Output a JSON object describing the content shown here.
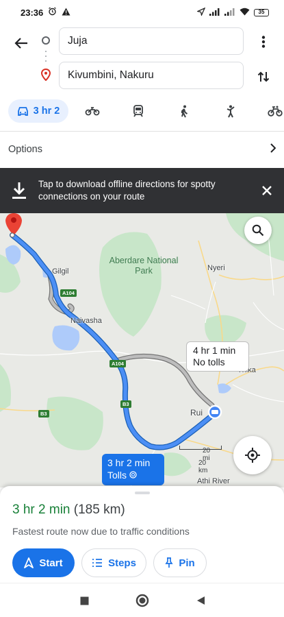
{
  "status_bar": {
    "time": "23:36",
    "battery": "35"
  },
  "search": {
    "origin": "Juja",
    "destination": "Kivumbini, Nakuru"
  },
  "modes": [
    {
      "name": "car-icon",
      "label": "3 hr 2",
      "selected": true
    },
    {
      "name": "motorcycle-icon"
    },
    {
      "name": "transit-icon"
    },
    {
      "name": "walk-icon"
    },
    {
      "name": "ride-hailing-icon"
    },
    {
      "name": "bike-icon"
    }
  ],
  "options": {
    "label": "Options"
  },
  "banner": {
    "text": "Tap to download offline directions for spotty connections on your route"
  },
  "map": {
    "places": {
      "gilgil": "Gilgil",
      "naivasha": "Naivasha",
      "nyeri": "Nyeri",
      "thika": "Thika",
      "ruiru": "Rui",
      "athi_river": "Athi River",
      "aberdare": "Aberdare National Park"
    },
    "road_tags": {
      "a104_north": "A104",
      "a104_south": "A104",
      "b3_left": "B3",
      "b3_right": "B3"
    },
    "alt_route": {
      "time": "4 hr 1 min",
      "note": "No tolls"
    },
    "main_route": {
      "time": "3 hr 2 min",
      "note": "Tolls"
    },
    "scale": {
      "mi": "20 mi",
      "km": "20 km"
    }
  },
  "sheet": {
    "duration": "3 hr 2 min",
    "distance": "(185 km)",
    "subtitle": "Fastest route now due to traffic conditions",
    "start_label": "Start",
    "steps_label": "Steps",
    "pin_label": "Pin"
  },
  "colors": {
    "accent": "#1a73e8",
    "route": "#4285f4",
    "green_text": "#188038",
    "banner_bg": "#303134"
  }
}
